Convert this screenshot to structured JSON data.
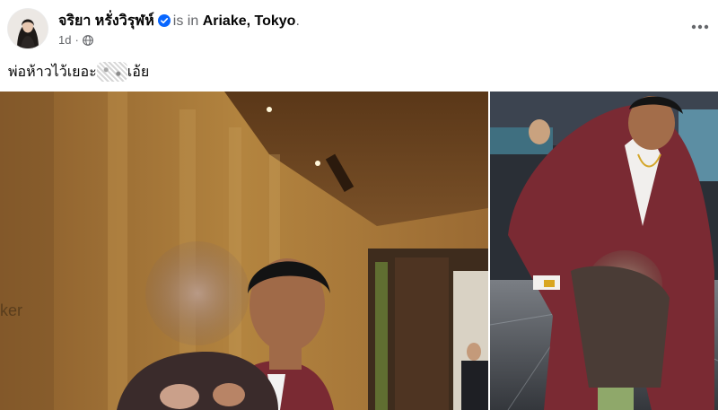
{
  "post": {
    "author_name": "จริยา หรั่งวิรุฬห์",
    "is_in_text": "is in",
    "location": "Ariake, Tokyo",
    "location_suffix": ".",
    "time": "1d",
    "separator": "·",
    "audience_icon": "globe-icon",
    "more_icon": "more-options-icon",
    "text_before": "พ่อห้าวไว้เยอะ",
    "text_after": "เอ้ย",
    "verified_icon": "verified-badge-icon"
  },
  "photos": [
    {
      "name": "left-photo",
      "visible_text": "ker",
      "description_icon": "photo"
    },
    {
      "name": "right-photo",
      "visible_text": "",
      "description_icon": "photo"
    }
  ],
  "colors": {
    "verified_blue": "#0866ff",
    "secondary_text": "#65676b",
    "suit_maroon": "#7a2a33",
    "wall_gold": "#a9793c"
  }
}
